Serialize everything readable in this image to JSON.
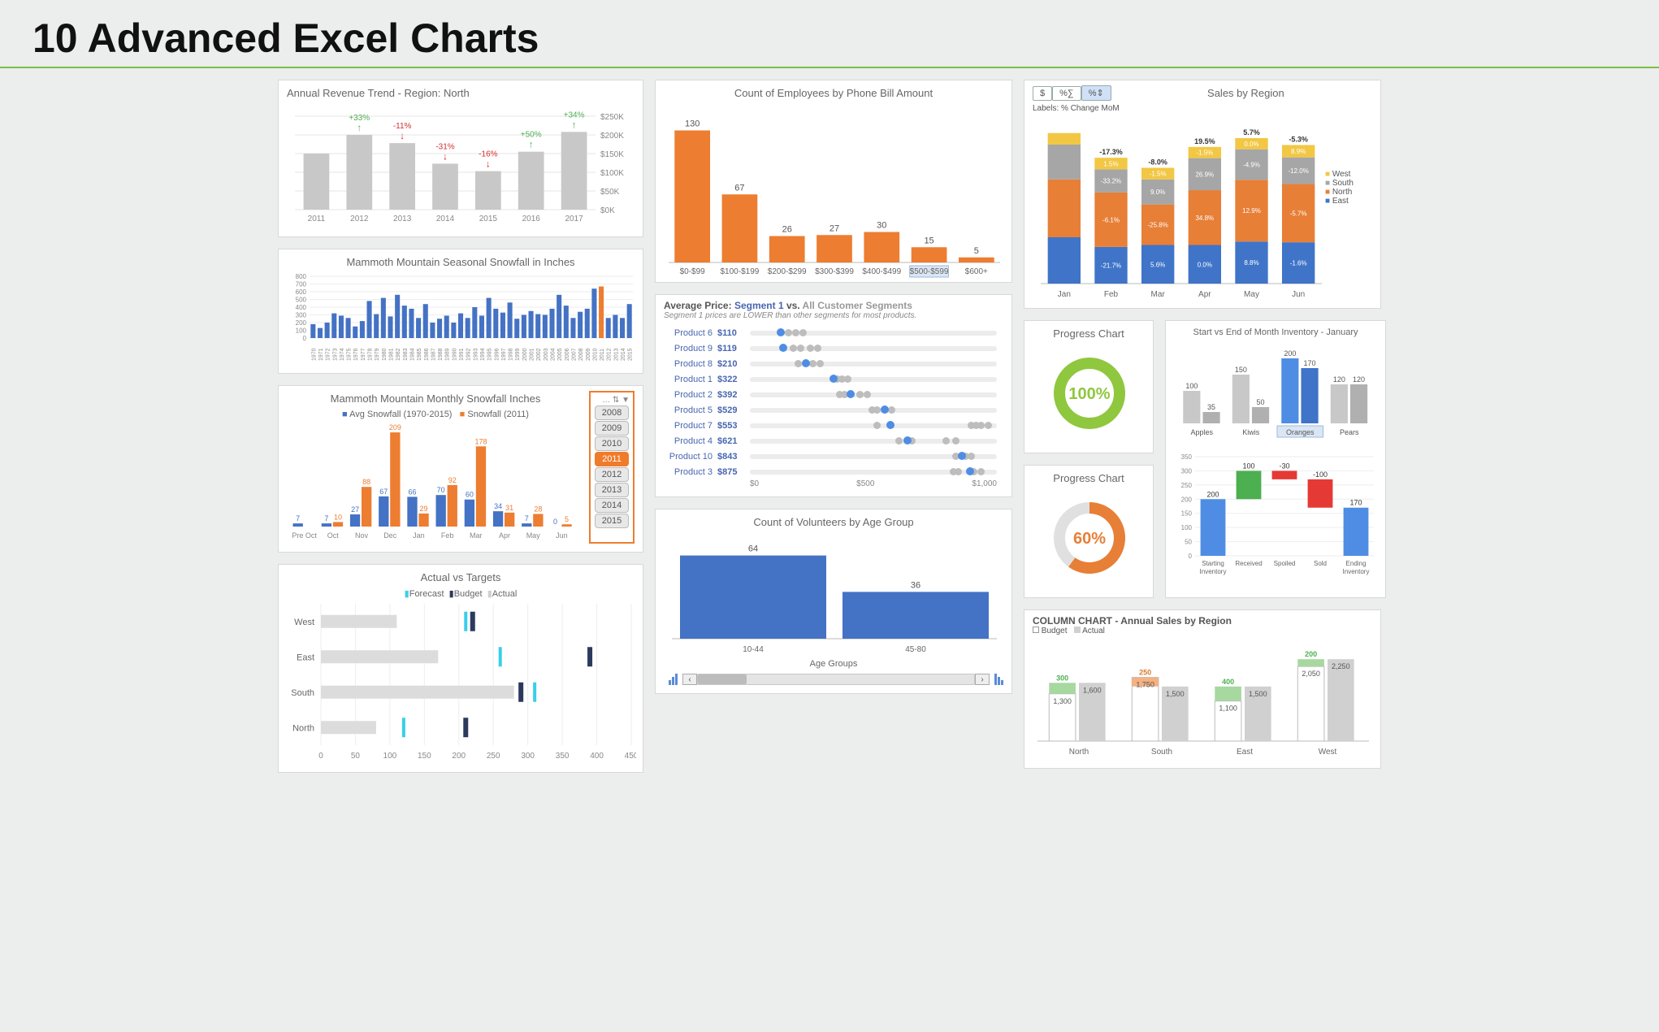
{
  "page_title": "10 Advanced Excel Charts",
  "chart_data": [
    {
      "id": "c1",
      "type": "bar",
      "title": "Annual Revenue Trend - Region: North",
      "categories": [
        "2011",
        "2012",
        "2013",
        "2014",
        "2015",
        "2016",
        "2017"
      ],
      "values": [
        150,
        200,
        178,
        123,
        103,
        155,
        208
      ],
      "change_labels": [
        "",
        "+33%",
        "-11%",
        "-31%",
        "-16%",
        "+50%",
        "+34%"
      ],
      "ylim": [
        0,
        250
      ],
      "yticks": [
        "$0K",
        "$50K",
        "$100K",
        "$150K",
        "$200K",
        "$250K"
      ]
    },
    {
      "id": "c2",
      "type": "bar",
      "title": "Mammoth Mountain Seasonal Snowfall in Inches",
      "categories": [
        "1970",
        "1971",
        "1972",
        "1973",
        "1974",
        "1975",
        "1976",
        "1977",
        "1978",
        "1979",
        "1980",
        "1981",
        "1982",
        "1983",
        "1984",
        "1985",
        "1986",
        "1987",
        "1988",
        "1989",
        "1990",
        "1991",
        "1992",
        "1993",
        "1994",
        "1995",
        "1996",
        "1997",
        "1998",
        "1999",
        "2000",
        "2001",
        "2002",
        "2003",
        "2004",
        "2005",
        "2006",
        "2007",
        "2008",
        "2009",
        "2010",
        "2011",
        "2012",
        "2013",
        "2014",
        "2015"
      ],
      "values": [
        180,
        130,
        200,
        320,
        290,
        260,
        150,
        220,
        480,
        310,
        520,
        280,
        560,
        420,
        380,
        260,
        440,
        200,
        250,
        290,
        200,
        320,
        260,
        400,
        290,
        520,
        380,
        330,
        460,
        250,
        300,
        350,
        310,
        300,
        380,
        560,
        420,
        260,
        340,
        380,
        640,
        668,
        260,
        300,
        260,
        440
      ],
      "highlight_index": 41,
      "ylim": [
        0,
        800
      ],
      "yticks": [
        0,
        100,
        200,
        300,
        400,
        500,
        600,
        700,
        800
      ]
    },
    {
      "id": "c3",
      "type": "bar",
      "title": "Mammoth Mountain Monthly Snowfall Inches",
      "legend": [
        "Avg Snowfall (1970-2015)",
        "Snowfall (2011)"
      ],
      "categories": [
        "Pre Oct",
        "Oct",
        "Nov",
        "Dec",
        "Jan",
        "Feb",
        "Mar",
        "Apr",
        "May",
        "Jun"
      ],
      "series": [
        {
          "name": "Avg Snowfall (1970-2015)",
          "values": [
            7,
            7,
            27,
            67,
            66,
            70,
            60,
            34,
            7,
            0
          ]
        },
        {
          "name": "Snowfall (2011)",
          "values": [
            0,
            10,
            88,
            209,
            29,
            92,
            178,
            31,
            28,
            5
          ]
        }
      ],
      "labels": [
        [
          "7",
          ""
        ],
        [
          "7",
          "10"
        ],
        [
          "27",
          "88"
        ],
        [
          "67",
          "209"
        ],
        [
          "66",
          "29"
        ],
        [
          "70",
          "92"
        ],
        [
          "60",
          "178"
        ],
        [
          "34",
          "31"
        ],
        [
          "7",
          "28"
        ],
        [
          "0",
          "5"
        ]
      ],
      "year_slicer": [
        "2008",
        "2009",
        "2010",
        "2011",
        "2012",
        "2013",
        "2014",
        "2015"
      ],
      "selected_year": "2011",
      "ylim": [
        0,
        220
      ]
    },
    {
      "id": "c4",
      "type": "bar-horizontal",
      "title": "Actual vs Targets",
      "legend": [
        "Forecast",
        "Budget",
        "Actual"
      ],
      "categories": [
        "West",
        "East",
        "South",
        "North"
      ],
      "series": [
        {
          "name": "Actual",
          "values": [
            110,
            170,
            280,
            80
          ]
        },
        {
          "name": "Forecast",
          "values": [
            210,
            260,
            310,
            120
          ]
        },
        {
          "name": "Budget",
          "values": [
            220,
            390,
            290,
            210
          ]
        }
      ],
      "xlim": [
        0,
        450
      ],
      "xticks": [
        0,
        50,
        100,
        150,
        200,
        250,
        300,
        350,
        400,
        450
      ]
    },
    {
      "id": "c5",
      "type": "bar",
      "title": "Count of Employees by Phone Bill Amount",
      "categories": [
        "$0-$99",
        "$100-$199",
        "$200-$299",
        "$300-$399",
        "$400-$499",
        "$500-$599",
        "$600+"
      ],
      "values": [
        130,
        67,
        26,
        27,
        30,
        15,
        5
      ],
      "highlighted_category": "$500-$599",
      "ylim": [
        0,
        140
      ]
    },
    {
      "id": "c6",
      "type": "table-dotplot",
      "title": "Average Price: Segment 1 vs. All Customer Segments",
      "subtitle": "Segment 1 prices are LOWER than other segments for most products.",
      "rows": [
        {
          "name": "Product 6",
          "price": 110,
          "others": [
            140,
            170,
            200
          ]
        },
        {
          "name": "Product 9",
          "price": 119,
          "others": [
            160,
            190,
            230,
            260
          ]
        },
        {
          "name": "Product 8",
          "price": 210,
          "others": [
            180,
            240,
            270
          ]
        },
        {
          "name": "Product 1",
          "price": 322,
          "others": [
            340,
            360,
            380
          ]
        },
        {
          "name": "Product 2",
          "price": 392,
          "others": [
            350,
            370,
            430,
            460
          ]
        },
        {
          "name": "Product 5",
          "price": 529,
          "others": [
            480,
            500,
            560
          ]
        },
        {
          "name": "Product 7",
          "price": 553,
          "others": [
            500,
            880,
            900,
            920,
            950
          ]
        },
        {
          "name": "Product 4",
          "price": 621,
          "others": [
            590,
            640,
            780,
            820
          ]
        },
        {
          "name": "Product 10",
          "price": 843,
          "others": [
            820,
            860,
            880
          ]
        },
        {
          "name": "Product 3",
          "price": 875,
          "others": [
            810,
            830,
            890,
            920
          ]
        }
      ],
      "xlim": [
        0,
        1000
      ],
      "xticks": [
        "$0",
        "$500",
        "$1,000"
      ]
    },
    {
      "id": "c7",
      "type": "bar",
      "title": "Count of Volunteers by Age Group",
      "xlabel": "Age Groups",
      "categories": [
        "10-44",
        "45-80"
      ],
      "values": [
        64,
        36
      ],
      "ylim": [
        0,
        70
      ]
    },
    {
      "id": "c8",
      "type": "stacked-bar",
      "title": "Sales by Region",
      "toggles": [
        "$",
        "%∑",
        "%⇕"
      ],
      "selected_toggle": "%⇕",
      "labels_note": "Labels: % Change MoM",
      "legend": [
        "West",
        "South",
        "North",
        "East"
      ],
      "categories": [
        "Jan",
        "Feb",
        "Mar",
        "Apr",
        "May",
        "Jun"
      ],
      "header_labels": [
        "",
        "-17.3%",
        "-8.0%",
        "19.5%",
        "5.7%",
        "-5.3%"
      ],
      "series": [
        {
          "name": "East",
          "color": "#3f74c8",
          "values": [
            120,
            95,
            100,
            100,
            109,
            107
          ],
          "labels": [
            "",
            "-21.7%",
            "5.6%",
            "0.0%",
            "8.8%",
            "-1.6%"
          ]
        },
        {
          "name": "North",
          "color": "#e77f37",
          "values": [
            150,
            141,
            105,
            142,
            160,
            151
          ],
          "labels": [
            "",
            "-6.1%",
            "-25.8%",
            "34.8%",
            "12.9%",
            "-5.7%"
          ]
        },
        {
          "name": "South",
          "color": "#a6a6a6",
          "values": [
            90,
            60,
            65,
            83,
            79,
            69
          ],
          "labels": [
            "",
            "-33.2%",
            "9.0%",
            "26.9%",
            "-4.9%",
            "-12.0%"
          ]
        },
        {
          "name": "West",
          "color": "#f2c744",
          "values": [
            30,
            30,
            30,
            29,
            29,
            32
          ],
          "labels": [
            "",
            "1.5%",
            "-1.5%",
            "-1.5%",
            "0.0%",
            "8.9%"
          ]
        }
      ],
      "ylim": [
        0,
        400
      ]
    },
    {
      "id": "c9",
      "type": "donut",
      "title": "Progress Chart",
      "value": 100,
      "display": "100%",
      "color": "#8fc73e"
    },
    {
      "id": "c10",
      "type": "donut",
      "title": "Progress Chart",
      "value": 60,
      "display": "60%",
      "color": "#e77f37"
    },
    {
      "id": "c11",
      "type": "bar",
      "title": "Start vs End of Month Inventory - January",
      "categories": [
        "Apples",
        "Kiwis",
        "Oranges",
        "Pears"
      ],
      "series": [
        {
          "name": "Start",
          "values": [
            100,
            150,
            200,
            120
          ]
        },
        {
          "name": "End",
          "values": [
            35,
            50,
            170,
            120
          ]
        }
      ],
      "highlighted_category": "Oranges",
      "ylim": [
        0,
        210
      ]
    },
    {
      "id": "c12",
      "type": "waterfall",
      "title": "",
      "categories": [
        "Starting Inventory",
        "Received",
        "Spoiled",
        "Sold",
        "Ending Inventory"
      ],
      "values": [
        200,
        100,
        -30,
        -100,
        170
      ],
      "labels": [
        "200",
        "100",
        "-30",
        "-100",
        "170"
      ],
      "xlabel_lines": [
        [
          "Starting",
          "Inventory"
        ],
        [
          "Received"
        ],
        [
          "Spoiled"
        ],
        [
          "Sold"
        ],
        [
          "Ending",
          "Inventory"
        ]
      ],
      "yticks": [
        0,
        50,
        100,
        150,
        200,
        250,
        300,
        350
      ],
      "ylim": [
        0,
        350
      ]
    },
    {
      "id": "c13",
      "type": "bar",
      "title": "COLUMN CHART - Annual Sales by Region",
      "legend": [
        "Budget",
        "Actual"
      ],
      "categories": [
        "North",
        "South",
        "East",
        "West"
      ],
      "series": [
        {
          "name": "Budget",
          "values": [
            1300,
            1750,
            1100,
            2050
          ]
        },
        {
          "name": "Actual",
          "values": [
            1600,
            1500,
            1500,
            2250
          ]
        }
      ],
      "diff_labels": [
        "300",
        "250",
        "400",
        "200"
      ],
      "value_labels": [
        [
          "1,300",
          "1,600"
        ],
        [
          "1,750",
          "1,500"
        ],
        [
          "1,100",
          "1,500"
        ],
        [
          "2,050",
          "2,250"
        ]
      ],
      "ylim": [
        0,
        2500
      ]
    }
  ]
}
